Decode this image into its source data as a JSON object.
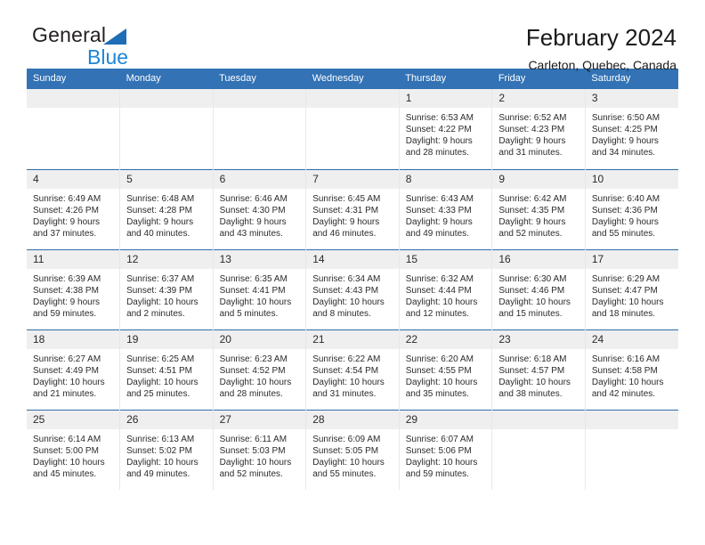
{
  "brand": {
    "name_dark": "General",
    "name_blue": "Blue",
    "triangle_icon": "triangle-icon"
  },
  "header": {
    "title": "February 2024",
    "location": "Carleton, Quebec, Canada"
  },
  "colors": {
    "header_blue": "#3272b5",
    "row_rule_blue": "#2e6da8",
    "daynum_band": "#efefef",
    "brand_blue": "#1e86d6",
    "brand_triangle": "#1e6db5"
  },
  "weekday_headers": [
    "Sunday",
    "Monday",
    "Tuesday",
    "Wednesday",
    "Thursday",
    "Friday",
    "Saturday"
  ],
  "weeks": [
    [
      {
        "day": "",
        "lines": []
      },
      {
        "day": "",
        "lines": []
      },
      {
        "day": "",
        "lines": []
      },
      {
        "day": "",
        "lines": []
      },
      {
        "day": "1",
        "lines": [
          "Sunrise: 6:53 AM",
          "Sunset: 4:22 PM",
          "Daylight: 9 hours and 28 minutes."
        ]
      },
      {
        "day": "2",
        "lines": [
          "Sunrise: 6:52 AM",
          "Sunset: 4:23 PM",
          "Daylight: 9 hours and 31 minutes."
        ]
      },
      {
        "day": "3",
        "lines": [
          "Sunrise: 6:50 AM",
          "Sunset: 4:25 PM",
          "Daylight: 9 hours and 34 minutes."
        ]
      }
    ],
    [
      {
        "day": "4",
        "lines": [
          "Sunrise: 6:49 AM",
          "Sunset: 4:26 PM",
          "Daylight: 9 hours and 37 minutes."
        ]
      },
      {
        "day": "5",
        "lines": [
          "Sunrise: 6:48 AM",
          "Sunset: 4:28 PM",
          "Daylight: 9 hours and 40 minutes."
        ]
      },
      {
        "day": "6",
        "lines": [
          "Sunrise: 6:46 AM",
          "Sunset: 4:30 PM",
          "Daylight: 9 hours and 43 minutes."
        ]
      },
      {
        "day": "7",
        "lines": [
          "Sunrise: 6:45 AM",
          "Sunset: 4:31 PM",
          "Daylight: 9 hours and 46 minutes."
        ]
      },
      {
        "day": "8",
        "lines": [
          "Sunrise: 6:43 AM",
          "Sunset: 4:33 PM",
          "Daylight: 9 hours and 49 minutes."
        ]
      },
      {
        "day": "9",
        "lines": [
          "Sunrise: 6:42 AM",
          "Sunset: 4:35 PM",
          "Daylight: 9 hours and 52 minutes."
        ]
      },
      {
        "day": "10",
        "lines": [
          "Sunrise: 6:40 AM",
          "Sunset: 4:36 PM",
          "Daylight: 9 hours and 55 minutes."
        ]
      }
    ],
    [
      {
        "day": "11",
        "lines": [
          "Sunrise: 6:39 AM",
          "Sunset: 4:38 PM",
          "Daylight: 9 hours and 59 minutes."
        ]
      },
      {
        "day": "12",
        "lines": [
          "Sunrise: 6:37 AM",
          "Sunset: 4:39 PM",
          "Daylight: 10 hours and 2 minutes."
        ]
      },
      {
        "day": "13",
        "lines": [
          "Sunrise: 6:35 AM",
          "Sunset: 4:41 PM",
          "Daylight: 10 hours and 5 minutes."
        ]
      },
      {
        "day": "14",
        "lines": [
          "Sunrise: 6:34 AM",
          "Sunset: 4:43 PM",
          "Daylight: 10 hours and 8 minutes."
        ]
      },
      {
        "day": "15",
        "lines": [
          "Sunrise: 6:32 AM",
          "Sunset: 4:44 PM",
          "Daylight: 10 hours and 12 minutes."
        ]
      },
      {
        "day": "16",
        "lines": [
          "Sunrise: 6:30 AM",
          "Sunset: 4:46 PM",
          "Daylight: 10 hours and 15 minutes."
        ]
      },
      {
        "day": "17",
        "lines": [
          "Sunrise: 6:29 AM",
          "Sunset: 4:47 PM",
          "Daylight: 10 hours and 18 minutes."
        ]
      }
    ],
    [
      {
        "day": "18",
        "lines": [
          "Sunrise: 6:27 AM",
          "Sunset: 4:49 PM",
          "Daylight: 10 hours and 21 minutes."
        ]
      },
      {
        "day": "19",
        "lines": [
          "Sunrise: 6:25 AM",
          "Sunset: 4:51 PM",
          "Daylight: 10 hours and 25 minutes."
        ]
      },
      {
        "day": "20",
        "lines": [
          "Sunrise: 6:23 AM",
          "Sunset: 4:52 PM",
          "Daylight: 10 hours and 28 minutes."
        ]
      },
      {
        "day": "21",
        "lines": [
          "Sunrise: 6:22 AM",
          "Sunset: 4:54 PM",
          "Daylight: 10 hours and 31 minutes."
        ]
      },
      {
        "day": "22",
        "lines": [
          "Sunrise: 6:20 AM",
          "Sunset: 4:55 PM",
          "Daylight: 10 hours and 35 minutes."
        ]
      },
      {
        "day": "23",
        "lines": [
          "Sunrise: 6:18 AM",
          "Sunset: 4:57 PM",
          "Daylight: 10 hours and 38 minutes."
        ]
      },
      {
        "day": "24",
        "lines": [
          "Sunrise: 6:16 AM",
          "Sunset: 4:58 PM",
          "Daylight: 10 hours and 42 minutes."
        ]
      }
    ],
    [
      {
        "day": "25",
        "lines": [
          "Sunrise: 6:14 AM",
          "Sunset: 5:00 PM",
          "Daylight: 10 hours and 45 minutes."
        ]
      },
      {
        "day": "26",
        "lines": [
          "Sunrise: 6:13 AM",
          "Sunset: 5:02 PM",
          "Daylight: 10 hours and 49 minutes."
        ]
      },
      {
        "day": "27",
        "lines": [
          "Sunrise: 6:11 AM",
          "Sunset: 5:03 PM",
          "Daylight: 10 hours and 52 minutes."
        ]
      },
      {
        "day": "28",
        "lines": [
          "Sunrise: 6:09 AM",
          "Sunset: 5:05 PM",
          "Daylight: 10 hours and 55 minutes."
        ]
      },
      {
        "day": "29",
        "lines": [
          "Sunrise: 6:07 AM",
          "Sunset: 5:06 PM",
          "Daylight: 10 hours and 59 minutes."
        ]
      },
      {
        "day": "",
        "lines": []
      },
      {
        "day": "",
        "lines": []
      }
    ]
  ]
}
